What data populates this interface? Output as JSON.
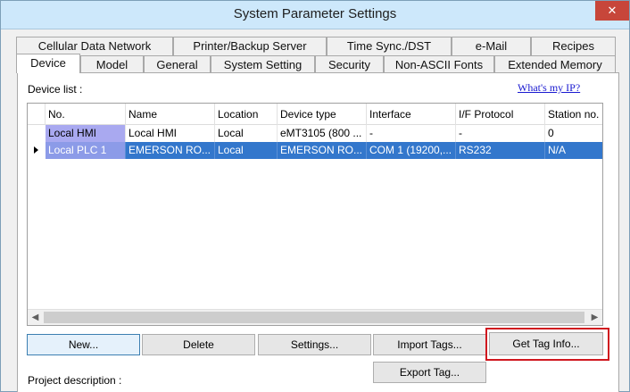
{
  "window": {
    "title": "System Parameter Settings",
    "close_glyph": "✕"
  },
  "tabs_row1": [
    {
      "label": "Cellular Data Network"
    },
    {
      "label": "Printer/Backup Server"
    },
    {
      "label": "Time Sync./DST"
    },
    {
      "label": "e-Mail"
    },
    {
      "label": "Recipes"
    }
  ],
  "tabs_row2": [
    {
      "label": "Device",
      "active": true
    },
    {
      "label": "Model"
    },
    {
      "label": "General"
    },
    {
      "label": "System Setting"
    },
    {
      "label": "Security"
    },
    {
      "label": "Non-ASCII Fonts"
    },
    {
      "label": "Extended Memory"
    }
  ],
  "device_list": {
    "label": "Device list :",
    "whats_my_ip": "What's my IP?",
    "columns": [
      "No.",
      "Name",
      "Location",
      "Device type",
      "Interface",
      "I/F Protocol",
      "Station no."
    ],
    "rows": [
      [
        "Local HMI",
        "Local HMI",
        "Local",
        "eMT3105 (800 ...",
        "-",
        "-",
        "0"
      ],
      [
        "Local PLC 1",
        "EMERSON RO...",
        "Local",
        "EMERSON RO...",
        "COM 1 (19200,...",
        "RS232",
        "N/A"
      ]
    ],
    "selected_row": 1
  },
  "buttons": {
    "new": "New...",
    "delete": "Delete",
    "settings": "Settings...",
    "import_tags": "Import Tags...",
    "get_tag_info": "Get Tag Info...",
    "export_tag": "Export Tag..."
  },
  "project_description_label": "Project description :",
  "colors": {
    "selection": "#3377cc",
    "highlight_box": "#d0171f",
    "link": "#1a1ad0"
  }
}
